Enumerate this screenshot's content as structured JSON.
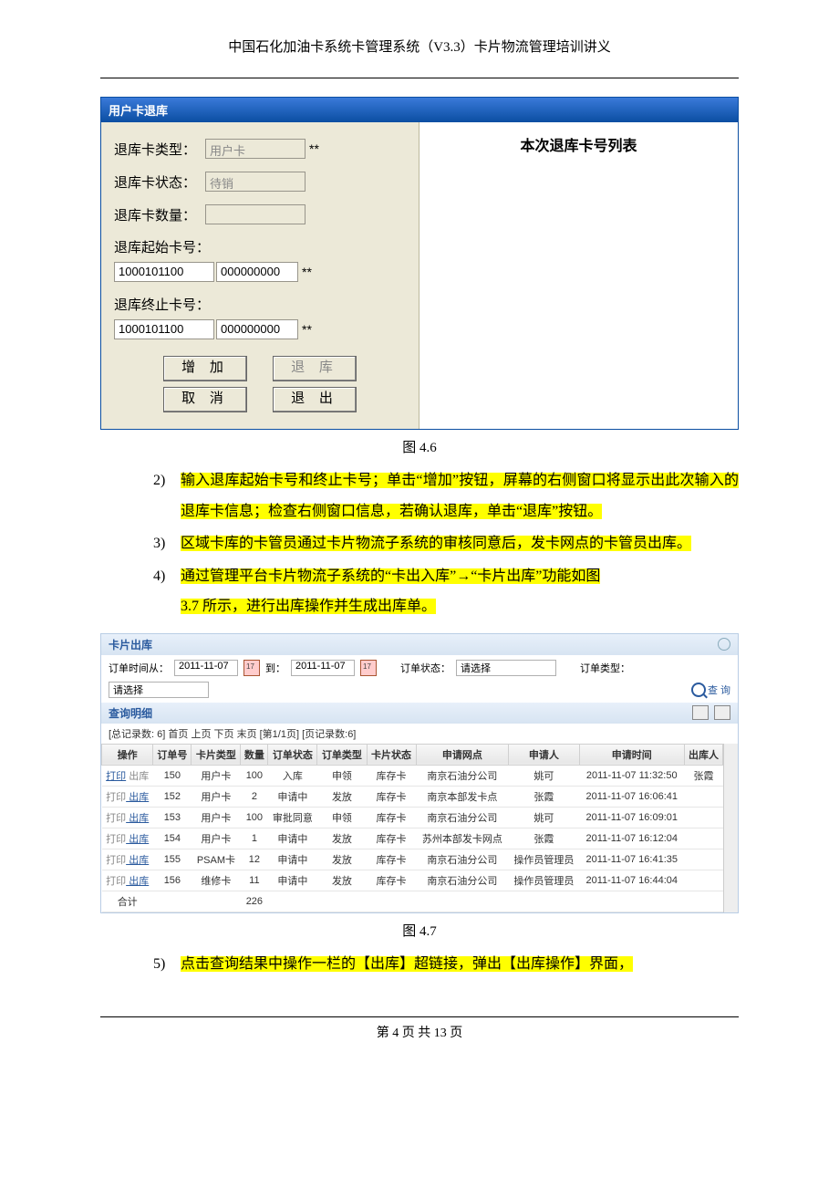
{
  "doc_header": "中国石化加油卡系统卡管理系统（V3.3）卡片物流管理培训讲义",
  "caption_46": "图 4.6",
  "caption_47": "图 4.7",
  "footer": "第 4 页 共 13 页",
  "dlg46": {
    "title": "用户卡退库",
    "label_card_type": "退库卡类型：",
    "value_card_type": "用户卡",
    "label_card_status": "退库卡状态：",
    "value_card_status": "待销",
    "label_card_qty": "退库卡数量：",
    "label_start_no": "退库起始卡号：",
    "label_end_no": "退库终止卡号：",
    "prefix": "1000101100",
    "num": "000000000",
    "asterisk": "**",
    "btn_add": "增 加",
    "btn_return": "退 库",
    "btn_cancel": "取 消",
    "btn_exit": "退 出",
    "right_title": "本次退库卡号列表"
  },
  "steps": {
    "s2_num": "2)",
    "s2_text": "输入退库起始卡号和终止卡号；单击“增加”按钮，屏幕的右侧窗口将显示出此次输入的退库卡信息；检查右侧窗口信息，若确认退库，单击“退库”按钮。",
    "s3_num": "3)",
    "s3_text": "区域卡库的卡管员通过卡片物流子系统的审核同意后，发卡网点的卡管员出库。",
    "s4_num": "4)",
    "s4_text_a": "通过管理平台卡片物流子系统的“卡出入库”→“卡片出库”功能如图",
    "s4_text_b": "3.7 所示，进行出库操作并生成出库单。",
    "s5_num": "5)",
    "s5_text": "点击查询结果中操作一栏的【出库】超链接，弹出【出库操作】界面，"
  },
  "fig47": {
    "panel_title": "卡片出库",
    "lbl_time_from": "订单时间从：",
    "date_from": "2011-11-07",
    "lbl_time_to": "到：",
    "date_to": "2011-11-07",
    "lbl_order_status": "订单状态：",
    "lbl_order_type": "订单类型：",
    "please_select": "请选择",
    "btn_search": "查 询",
    "subpanel_title": "查询明细",
    "pager_text": "[总记录数: 6] 首页 上页 下页 末页 [第1/1页] [页记录数:6]",
    "headers": [
      "操作",
      "订单号",
      "卡片类型",
      "数量",
      "订单状态",
      "订单类型",
      "卡片状态",
      "申请网点",
      "申请人",
      "申请时间",
      "出库人"
    ],
    "rows": [
      {
        "print": "打印",
        "out": "出库",
        "out_gray": true,
        "order": "150",
        "ctype": "用户卡",
        "qty": "100",
        "ostatus": "入库",
        "otype": "申领",
        "cstatus": "库存卡",
        "branch": "南京石油分公司",
        "applicant": "姚可",
        "time": "2011-11-07 11:32:50",
        "outp": "张霞"
      },
      {
        "print": "打印",
        "out": "出库",
        "out_gray": false,
        "order": "152",
        "ctype": "用户卡",
        "qty": "2",
        "ostatus": "申请中",
        "otype": "发放",
        "cstatus": "库存卡",
        "branch": "南京本部发卡点",
        "applicant": "张霞",
        "time": "2011-11-07 16:06:41",
        "outp": ""
      },
      {
        "print": "打印",
        "out": "出库",
        "out_gray": false,
        "order": "153",
        "ctype": "用户卡",
        "qty": "100",
        "ostatus": "审批同意",
        "otype": "申领",
        "cstatus": "库存卡",
        "branch": "南京石油分公司",
        "applicant": "姚可",
        "time": "2011-11-07 16:09:01",
        "outp": ""
      },
      {
        "print": "打印",
        "out": "出库",
        "out_gray": false,
        "order": "154",
        "ctype": "用户卡",
        "qty": "1",
        "ostatus": "申请中",
        "otype": "发放",
        "cstatus": "库存卡",
        "branch": "苏州本部发卡网点",
        "applicant": "张霞",
        "time": "2011-11-07 16:12:04",
        "outp": ""
      },
      {
        "print": "打印",
        "out": "出库",
        "out_gray": false,
        "order": "155",
        "ctype": "PSAM卡",
        "qty": "12",
        "ostatus": "申请中",
        "otype": "发放",
        "cstatus": "库存卡",
        "branch": "南京石油分公司",
        "applicant": "操作员管理员",
        "time": "2011-11-07 16:41:35",
        "outp": ""
      },
      {
        "print": "打印",
        "out": "出库",
        "out_gray": false,
        "order": "156",
        "ctype": "维修卡",
        "qty": "11",
        "ostatus": "申请中",
        "otype": "发放",
        "cstatus": "库存卡",
        "branch": "南京石油分公司",
        "applicant": "操作员管理员",
        "time": "2011-11-07 16:44:04",
        "outp": ""
      }
    ],
    "total_label": "合计",
    "total_qty": "226"
  }
}
